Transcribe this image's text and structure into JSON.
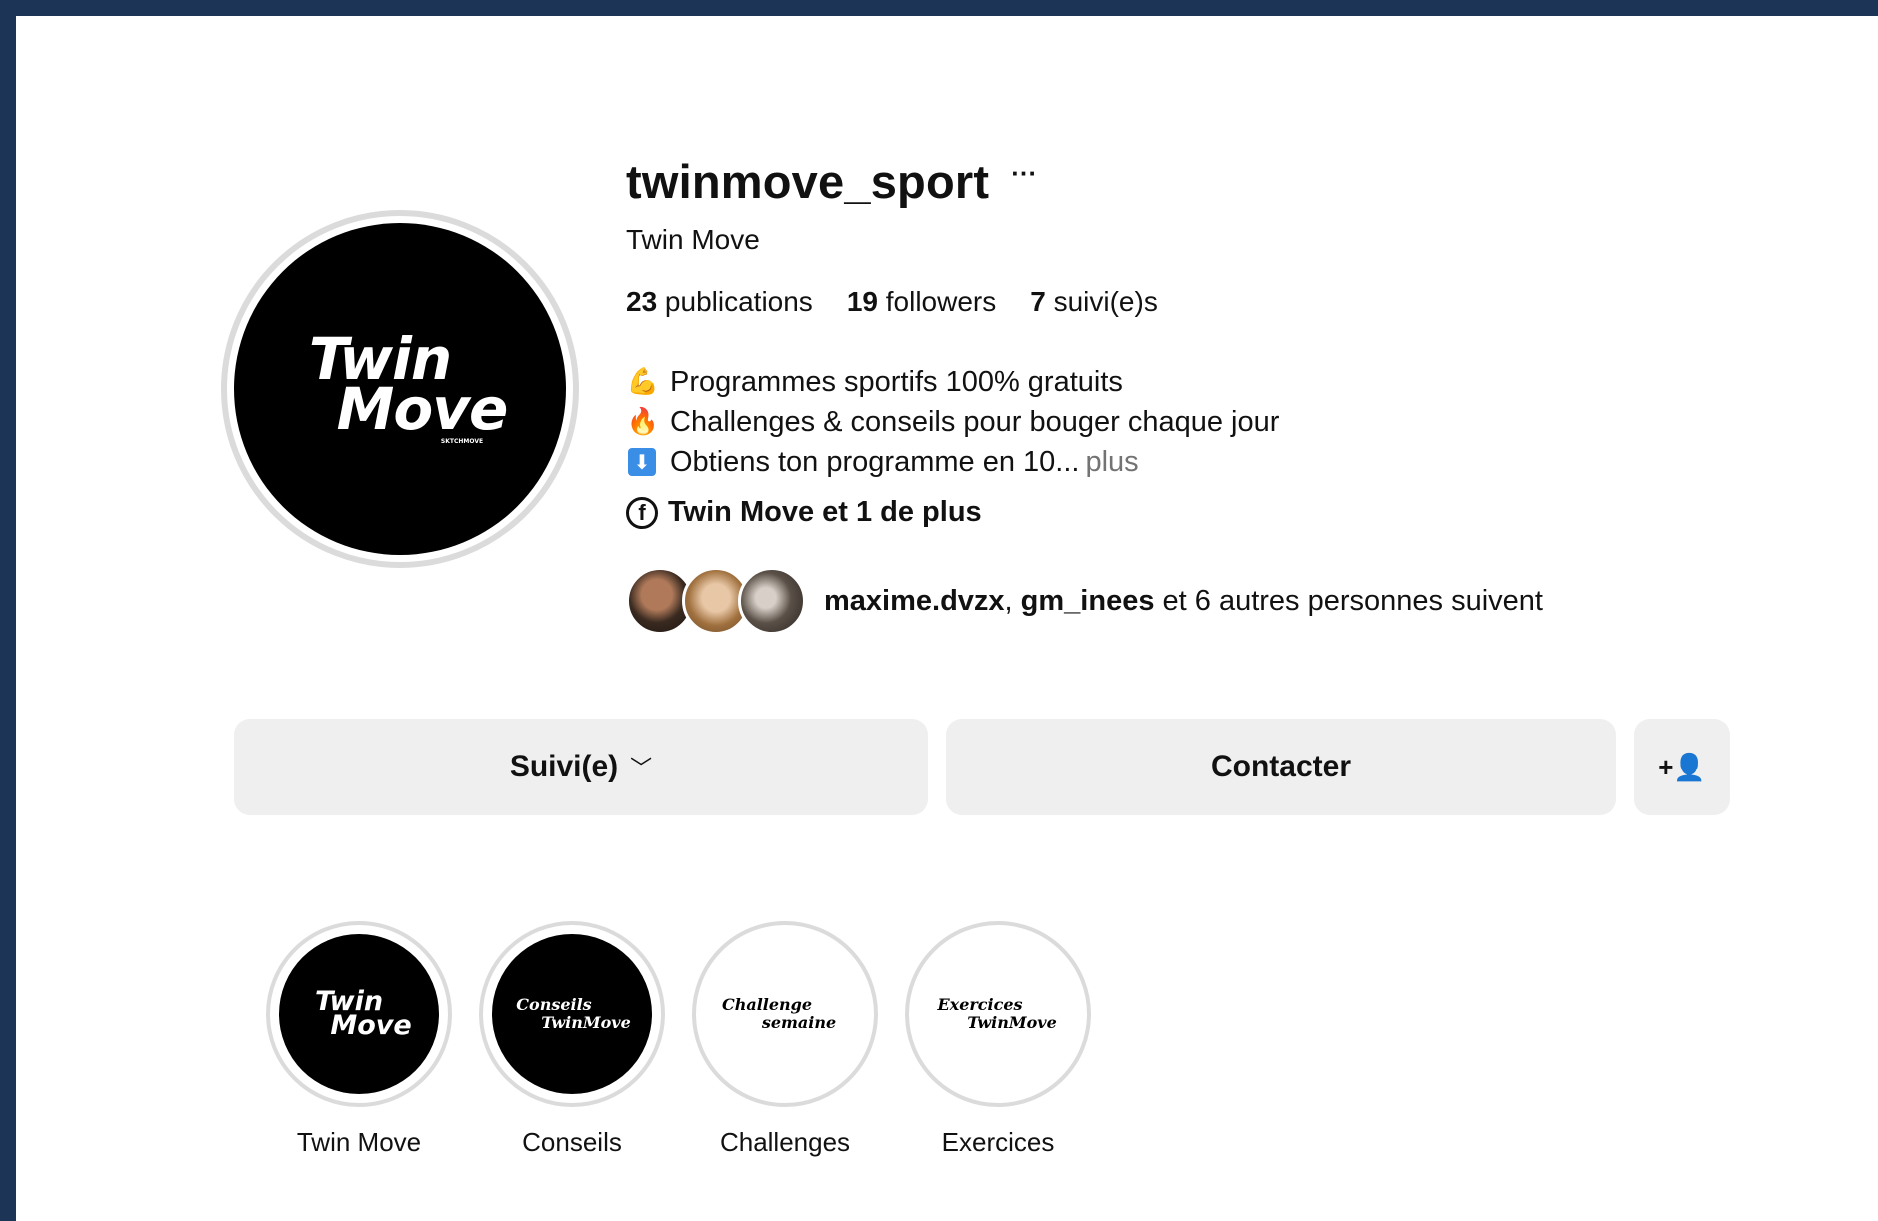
{
  "profile": {
    "username": "twinmove_sport",
    "more_label": "···",
    "full_name": "Twin Move",
    "avatar_logo": {
      "line1": "Twin",
      "line2": "Move",
      "small": "SKTCHMOVE"
    },
    "stats": [
      {
        "value": "23",
        "label": " publications"
      },
      {
        "value": "19",
        "label": " followers"
      },
      {
        "value": "7",
        "label": " suivi(e)s"
      }
    ],
    "bio": [
      {
        "emoji": "💪",
        "text": "Programmes sportifs 100% gratuits"
      },
      {
        "emoji": "🔥",
        "text": "Challenges & conseils pour bouger chaque jour"
      },
      {
        "emoji": "⬇",
        "text": "Obtiens ton programme en 10...",
        "more": "plus"
      }
    ],
    "link_text": "Twin Move et 1 de plus",
    "mutuals": {
      "user1": "maxime.dvzx",
      "sep": ", ",
      "user2": "gm_inees",
      "rest": " et 6 autres personnes suivent"
    }
  },
  "actions": {
    "follow_label": "Suivi(e)",
    "follow_chevron": "﹀",
    "contact_label": "Contacter",
    "add_user_icon": "+👤"
  },
  "highlights": [
    {
      "label": "Twin Move",
      "line1": "Twin",
      "line2": "Move",
      "style": "black-logo"
    },
    {
      "label": "Conseils",
      "line1": "Conseils",
      "line2": "TwinMove",
      "style": "black"
    },
    {
      "label": "Challenges",
      "line1": "Challenge",
      "line2": "semaine",
      "style": "white"
    },
    {
      "label": "Exercices",
      "line1": "Exercices",
      "line2": "TwinMove",
      "style": "white"
    }
  ],
  "colors": {
    "frame": "#1c3557",
    "button_bg": "#efefef",
    "muted": "#737373"
  }
}
